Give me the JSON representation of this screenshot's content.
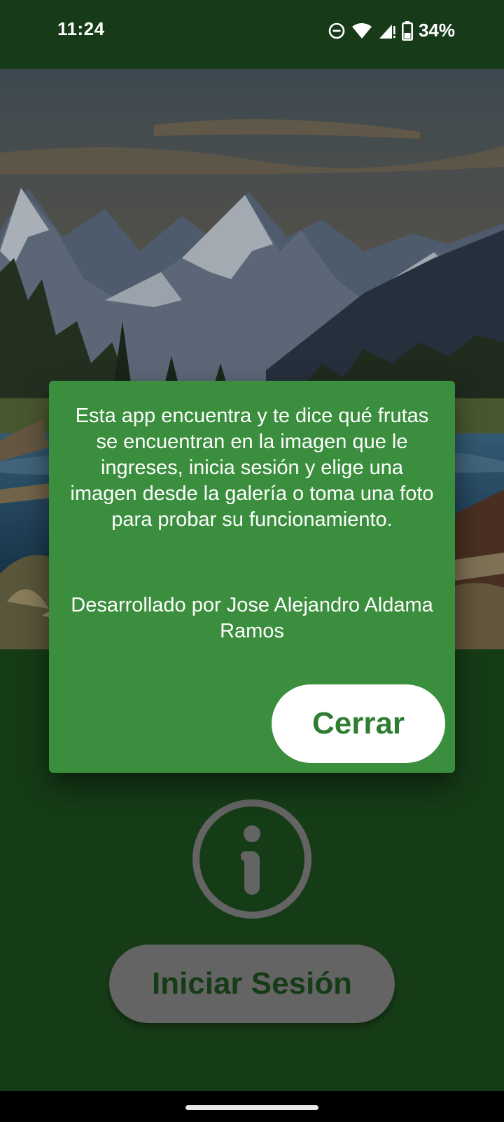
{
  "status_bar": {
    "time": "11:24",
    "battery_percent": "34%",
    "icons": [
      "do-not-disturb-icon",
      "wifi-icon",
      "cell-signal-icon",
      "battery-icon"
    ]
  },
  "background_image": {
    "icon": "mountain-lake-illustration"
  },
  "dialog": {
    "message": "Esta app encuentra y te dice qué frutas se encuentran en la imagen que le ingreses, inicia sesión y elige una imagen desde la galería o toma una foto para probar su funcionamiento.",
    "credit": "Desarrollado por Jose Alejandro Aldama Ramos",
    "close_label": "Cerrar"
  },
  "main": {
    "info_icon": "info-circle-icon",
    "login_label": "Iniciar Sesión"
  },
  "colors": {
    "app_background": "#1c4a1d",
    "dialog_background": "#3a8e3d",
    "close_button_text": "#2f7d33",
    "login_button_background": "#7a7a7a",
    "info_icon": "#7a7a7a"
  }
}
